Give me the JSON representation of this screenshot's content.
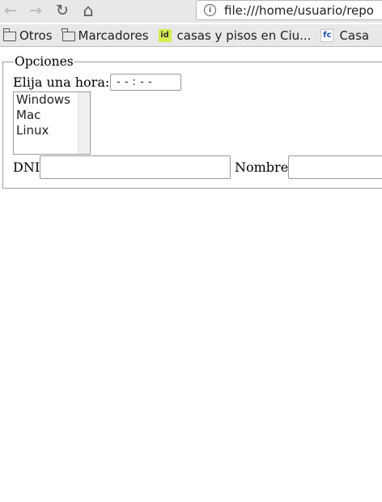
{
  "browser": {
    "back_icon": "←",
    "forward_icon": "→",
    "reload_icon": "↻",
    "home_icon": "⌂",
    "url": "file:///home/usuario/repo",
    "bookmarks": [
      {
        "label": "Otros"
      },
      {
        "label": "Marcadores"
      },
      {
        "label": "casas y pisos en Ciu...",
        "favicon": "id"
      },
      {
        "label": "Casa",
        "favicon": "fc"
      }
    ]
  },
  "form": {
    "legend": "Opciones",
    "hora_label": "Elija una hora:",
    "hora_value": "- - : - -",
    "os_options": [
      "Windows",
      "Mac",
      "Linux"
    ],
    "dni_label": "DNI",
    "nombre_label": "Nombre"
  }
}
